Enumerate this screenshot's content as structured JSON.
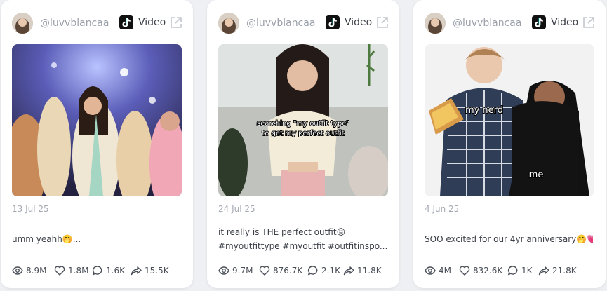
{
  "cards": [
    {
      "handle": "@luvvblancaa",
      "type_label": "Video",
      "date": "13 Jul 25",
      "caption": [
        "umm yeahh🤭..."
      ],
      "stats": {
        "views": "8.9M",
        "likes": "1.8M",
        "comments": "1.6K",
        "shares": "15.5K"
      }
    },
    {
      "handle": "@luvvblancaa",
      "type_label": "Video",
      "date": "24 Jul 25",
      "caption": [
        "it really is THE perfect outfit😝",
        "#myoutfittype #myoutfit #outfitinspo..."
      ],
      "overlay_text": [
        "searching \"my outfit type\"",
        "to get my perfect outfit"
      ],
      "stats": {
        "views": "9.7M",
        "likes": "876.7K",
        "comments": "2.1K",
        "shares": "11.8K"
      }
    },
    {
      "handle": "@luvvblancaa",
      "type_label": "Video",
      "date": "4 Jun 25",
      "caption": [
        "SOO excited for our 4yr anniversary🤭💗"
      ],
      "overlay_text": [
        "my nerd",
        "me"
      ],
      "stats": {
        "views": "4M",
        "likes": "832.6K",
        "comments": "1K",
        "shares": "21.8K"
      }
    }
  ],
  "icons": {
    "platform": "tiktok-icon",
    "open": "external-link-icon",
    "views": "eye-icon",
    "likes": "heart-icon",
    "comments": "comment-icon",
    "shares": "share-icon"
  },
  "colors": {
    "page_bg": "#eef0f3",
    "card_bg": "#ffffff",
    "muted_text": "#a4a9b2",
    "body_text": "#3b3f48"
  }
}
